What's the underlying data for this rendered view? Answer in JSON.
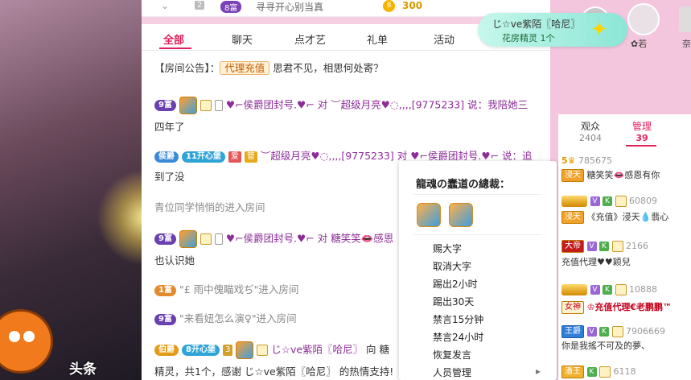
{
  "topbar": {
    "num": "2",
    "rank": "8富",
    "room_name": "寻寻开心别当真",
    "coin_symbol": "8",
    "coin_value": "300"
  },
  "tabs": [
    "全部",
    "聊天",
    "点才艺",
    "礼单",
    "活动"
  ],
  "notice": {
    "prefix": "【房间公告】：",
    "agent_tag": "代理充值",
    "text": " 思君不见，相思何处寄？"
  },
  "messages": [
    {
      "badge": "9富",
      "text1": "♥⌐侯爵团封号.♥⌐ 对 ︶超级月亮♥◌,,,,[9775233] 说：我陪她三",
      "text2": "四年了"
    },
    {
      "badge": "侯爵",
      "heart": "11开心堡",
      "text1": "︶超级月亮♥◌,,,,[9775233] 对 ♥⌐侯爵团封号.♥⌐ 说：追",
      "text2": "到了没"
    },
    {
      "text": "青位同学悄悄的进入房间"
    },
    {
      "badge": "9富",
      "text1": "♥⌐侯爵团封号.♥⌐ 对 ",
      "name2": "糖笑笑",
      "text2": "感恩",
      "text3": "也认识她"
    },
    {
      "badge": "1富",
      "text": "\"£ 雨中傀瞄戏ぢ\"进入房间"
    },
    {
      "badge": "9富",
      "text": "\"来看妞怎么演♀\"进入房间"
    },
    {
      "badge": "伯爵",
      "heart": "8开心堡",
      "level": "3",
      "name": "じ☆ve紫陌〖哈尼〗",
      "text": " 向 糖"
    },
    {
      "text": "精灵，共1个，感谢 じ☆ve紫陌〖哈尼〗 的热情支持!"
    }
  ],
  "popup": {
    "title": "龍魂の蠢道の總裁：",
    "items": [
      "赐大字",
      "取消大字",
      "踢出2小时",
      "踢出30天",
      "禁言15分钟",
      "禁言24小时",
      "恢复发言",
      "人员管理"
    ]
  },
  "right": {
    "user_name1": "✿若",
    "user_name2": "奈",
    "tabs": {
      "viewers": "观众",
      "viewers_count": "2404",
      "mgr": "管理",
      "mgr_count": "39"
    },
    "list": [
      {
        "level": "5",
        "id": "785675",
        "tag": "浸天",
        "name": "糖笑笑",
        "extra": "感恩有你"
      },
      {
        "id": "60809",
        "tag": "浸天",
        "name": "《充值》浸天💧翡心"
      },
      {
        "tag": "大帝",
        "id": "2166",
        "name": "充值代理♥♥颖兒"
      },
      {
        "tag": "女神",
        "id": "10888",
        "name": "♔充值代理€老鹏鹏™"
      },
      {
        "tag": "王爵",
        "id": "7906669",
        "name": "你是我搖不可及的夢、"
      },
      {
        "tag": "潘王",
        "id": "6118"
      }
    ]
  },
  "float": {
    "name": "じ☆ve紫陌〖哈尼〗",
    "sub": "花房精灵 1个"
  },
  "video": {
    "headline": "头条"
  }
}
